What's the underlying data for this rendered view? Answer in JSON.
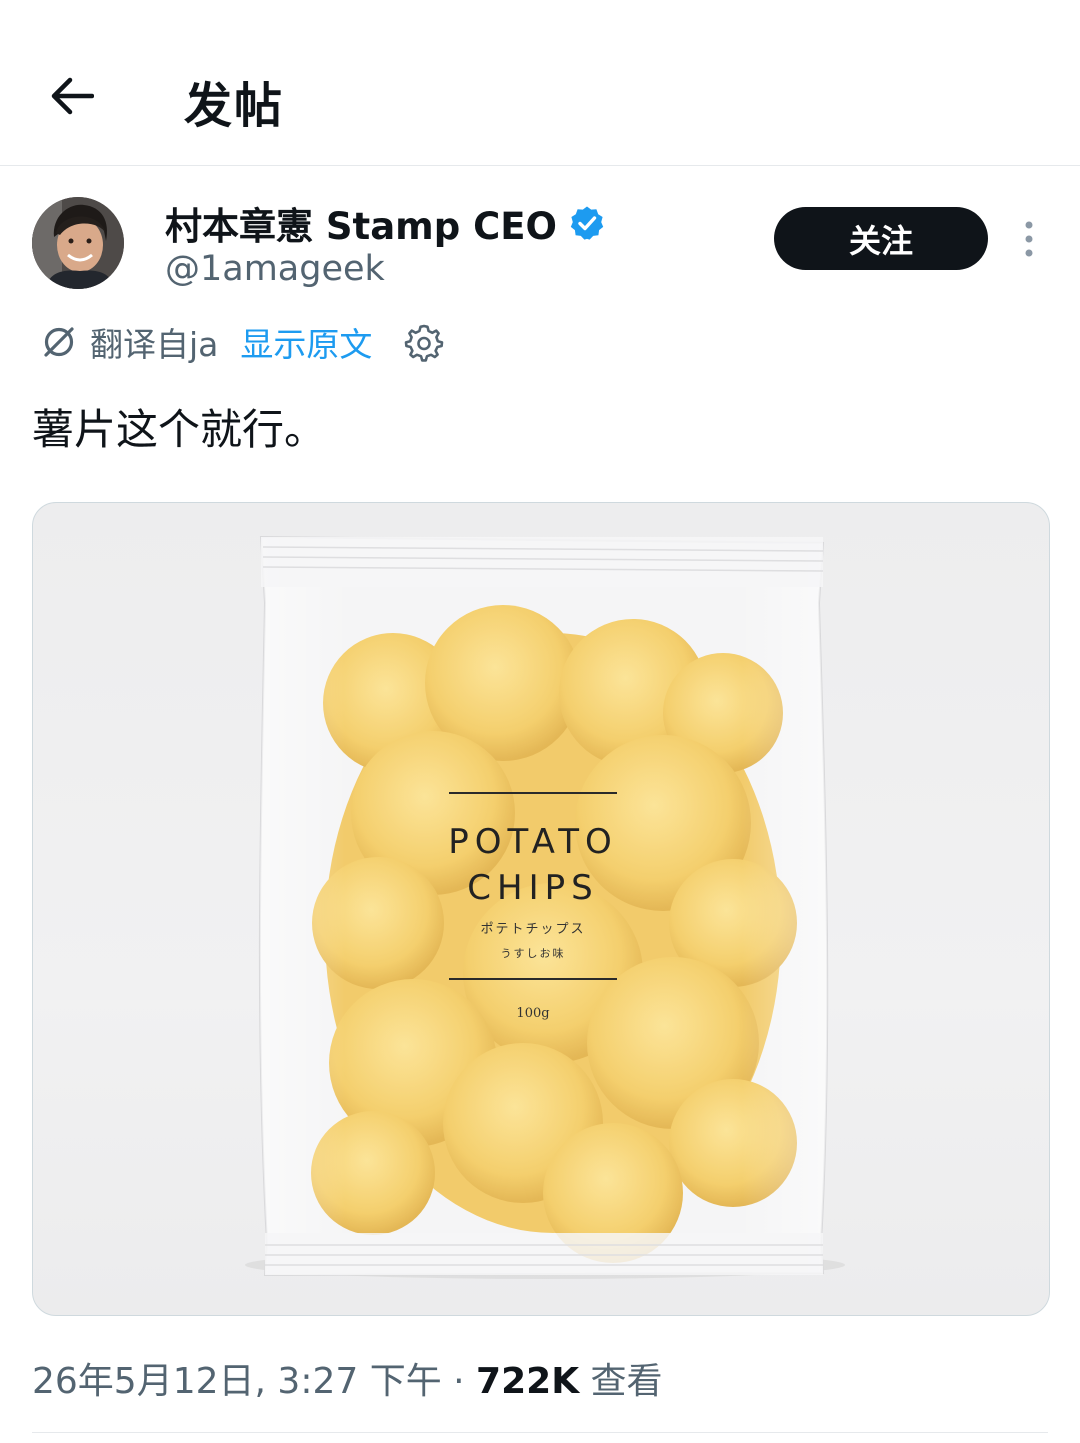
{
  "header": {
    "title": "发帖"
  },
  "author": {
    "display_name": "村本章憲 Stamp CEO",
    "handle": "@1amageek",
    "verified": true,
    "follow_label": "关注"
  },
  "translation": {
    "translated_from": "翻译自ja",
    "show_original": "显示原文"
  },
  "tweet": {
    "text": "薯片这个就行。"
  },
  "media": {
    "package_title_line1": "POTATO",
    "package_title_line2": "CHIPS",
    "package_subtitle_jp": "ポテトチップス",
    "package_flavor_jp": "うすしお味",
    "package_weight": "100g"
  },
  "meta": {
    "timestamp": "26年5月12日, 3:27 下午",
    "separator": " · ",
    "views_count": "722K",
    "views_label": " 查看"
  },
  "colors": {
    "accent": "#1d9bf0",
    "text_primary": "#0f1419",
    "text_secondary": "#536471",
    "follow_bg": "#0f1419"
  }
}
